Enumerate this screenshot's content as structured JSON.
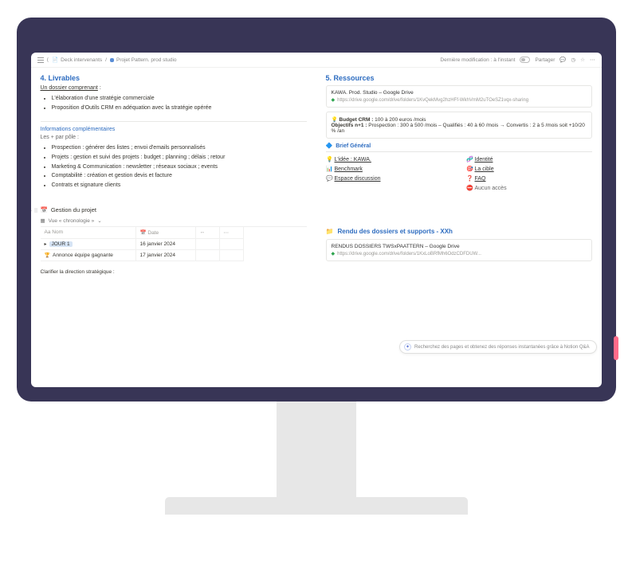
{
  "topbar": {
    "crumb1": "Deck intervenants",
    "crumb2": "Projet Pattern. prod studio",
    "modified": "Dernière modification : à l'instant",
    "share": "Partager"
  },
  "left": {
    "livrables": {
      "heading": "4. Livrables",
      "dossier_label": "Un dossier comprenant",
      "colon": " :",
      "items": [
        "L'élaboration d'une stratégie commerciale",
        "Proposition d'Outils CRM en adéquation avec la stratégie opérée"
      ]
    },
    "info": {
      "heading": "Informations complémentaires",
      "plus_label": "Les + par pôle :",
      "items": [
        "Prospection : générer des listes ; envoi d'emails personnalisés",
        "Projets : gestion et suivi des projets : budget ; planning ; délais ; retour",
        "Marketing & Communication : newsletter ; réseaux sociaux ; events",
        "Comptabilité : création et gestion devis et facture",
        "Contrats et signature clients"
      ]
    },
    "project": {
      "title": "Gestion du projet",
      "view": "Vue « chronologie »",
      "col_name": "Aa Nom",
      "col_date": "Date",
      "rows": [
        {
          "name": "JOUR 1",
          "date": "16 janvier 2024",
          "icon": "▸",
          "box": true
        },
        {
          "name": "Annonce équipe gagnante",
          "date": "17 janvier 2024",
          "icon": "🏆",
          "box": false
        }
      ],
      "clarify": "Clarifier la direction stratégique :"
    }
  },
  "right": {
    "ressources": {
      "heading": "5. Ressources",
      "drive1": {
        "title": "KAWA. Prod. Studio – Google Drive",
        "url": "https://drive.google.com/drive/folders/1KvQekMvg2hzHFf-WkhVmM2uTOeSZ1vqx-sharing"
      },
      "budget": {
        "l1_label": "Budget CRM :",
        "l1_val": " 100 à 200 euros /mois",
        "l2_label": "Objectifs n+1 :",
        "l2_val": " Prospection : 300 à 500 /mois – Qualifiés : 40 à 60 /mois → Convertis : 2 à 5 /mois soit +10/20 % /an"
      },
      "brief_title": "Brief Général",
      "links": [
        {
          "icon": "💡",
          "label": "L'idée : KAWA."
        },
        {
          "icon": "🧬",
          "label": "Identité"
        },
        {
          "icon": "📊",
          "label": "Benchmark"
        },
        {
          "icon": "🎯",
          "label": "La cible"
        },
        {
          "icon": "💬",
          "label": "Espace discussion"
        },
        {
          "icon": "❓",
          "label": "FAQ"
        },
        {
          "icon": "",
          "label": ""
        },
        {
          "icon": "⛔",
          "label": "Aucun accès"
        }
      ]
    },
    "rendu": {
      "heading": "Rendu des dossiers et supports - XXh",
      "drive": {
        "title": "RENDUS DOSSIERS TWSxPAATTERN – Google Drive",
        "url": "https://drive.google.com/drive/folders/1KxLoBRfMh6OdzCDFDUW..."
      }
    },
    "qa_hint": "Recherchez des pages et obtenez des réponses instantanées grâce à Notion Q&A"
  }
}
